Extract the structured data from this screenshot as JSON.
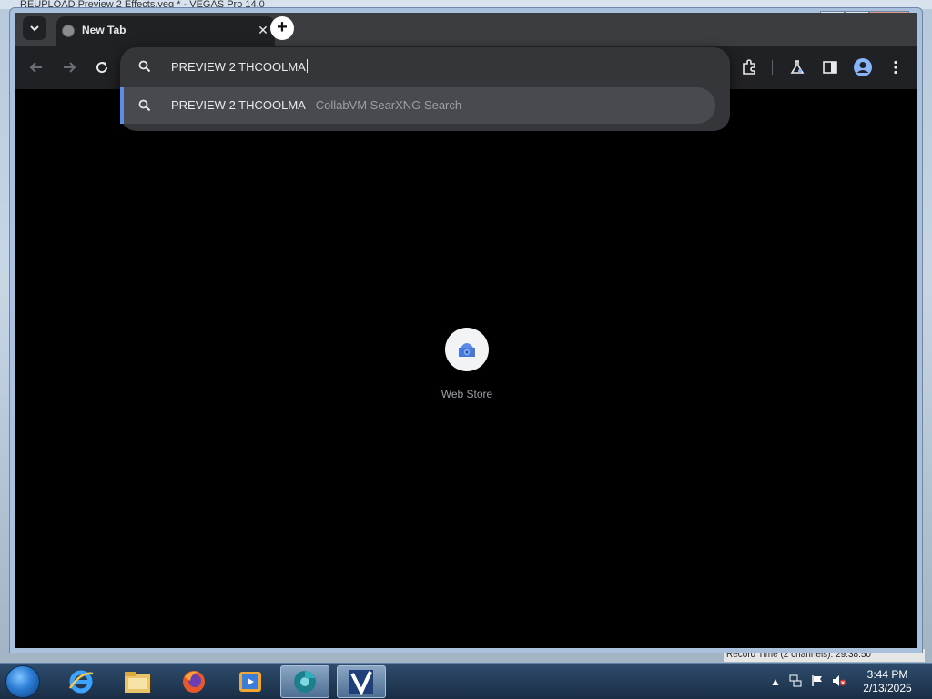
{
  "background_window": {
    "title": "REUPLOAD Preview 2 Effects.veg * - VEGAS Pro 14.0",
    "status_text": "Record Time (2 channels): 29:38:50"
  },
  "window_controls": {
    "minimize": "─",
    "maximize": "□",
    "close": "✕"
  },
  "browser": {
    "tab": {
      "title": "New Tab",
      "close": "✕"
    },
    "new_tab": "+",
    "omnibox": {
      "value": "PREVIEW 2 THCOOLMA",
      "suggestion": {
        "query": "PREVIEW 2 THCOOLMA",
        "separator": " - ",
        "description": "CollabVM SearXNG Search"
      }
    },
    "new_tab_page": {
      "shortcuts": [
        {
          "label": "Web Store",
          "icon": "web-store-icon"
        }
      ]
    },
    "colors": {
      "frame": "#3b3d40",
      "toolbar": "#202124",
      "popup": "#35363a",
      "suggestion_selected": "#484a4f",
      "accent": "#5c8fe8",
      "page": "#000000"
    }
  },
  "taskbar": {
    "items": [
      {
        "name": "internet-explorer-icon"
      },
      {
        "name": "file-explorer-icon"
      },
      {
        "name": "firefox-icon"
      },
      {
        "name": "media-player-icon"
      },
      {
        "name": "chrome-canary-icon",
        "active": true
      },
      {
        "name": "vegas-pro-icon",
        "active": true
      }
    ],
    "clock": {
      "time": "3:44 PM",
      "date": "2/13/2025"
    }
  }
}
